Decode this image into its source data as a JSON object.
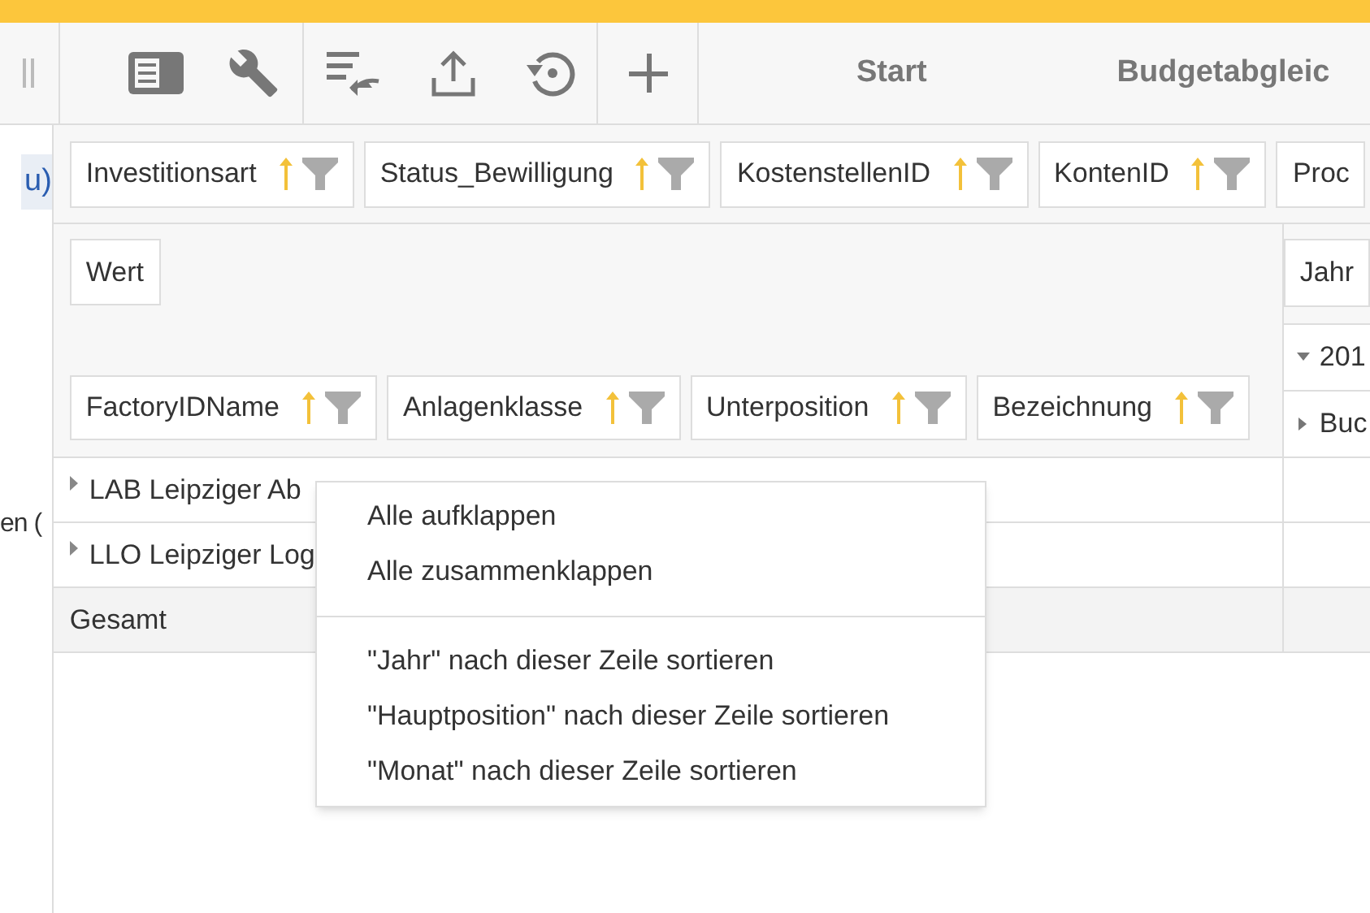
{
  "toolbar": {
    "tabs": [
      "Start",
      "Budgetabgleic"
    ]
  },
  "sidebar": {
    "texts": [
      "u)",
      "en ("
    ]
  },
  "filter_fields": [
    {
      "label": "Investitionsart",
      "kind": "field"
    },
    {
      "label": "Status_Bewilligung",
      "kind": "field"
    },
    {
      "label": "KostenstellenID",
      "kind": "field"
    },
    {
      "label": "KontenID",
      "kind": "field"
    },
    {
      "label": "Proc",
      "kind": "plain"
    }
  ],
  "data_fields": [
    {
      "label": "Wert"
    }
  ],
  "column_fields": [
    {
      "label": "Jahr"
    }
  ],
  "column_headers": [
    {
      "label": "201",
      "expanded": true
    },
    {
      "label": "Buc",
      "expanded": false
    }
  ],
  "row_fields": [
    {
      "label": "FactoryIDName",
      "kind": "field"
    },
    {
      "label": "Anlagenklasse",
      "kind": "field"
    },
    {
      "label": "Unterposition",
      "kind": "field"
    },
    {
      "label": "Bezeichnung",
      "kind": "field"
    }
  ],
  "rows": [
    {
      "label": "LAB Leipziger Ab",
      "kind": "group"
    },
    {
      "label": "LLO Leipziger Log",
      "kind": "group"
    },
    {
      "label": "Gesamt",
      "kind": "total"
    }
  ],
  "context_menu": {
    "groups": [
      [
        "Alle aufklappen",
        "Alle zusammenklappen"
      ],
      [
        "\"Jahr\" nach dieser Zeile sortieren",
        "\"Hauptposition\" nach dieser Zeile sortieren",
        "\"Monat\" nach dieser Zeile sortieren"
      ]
    ]
  }
}
